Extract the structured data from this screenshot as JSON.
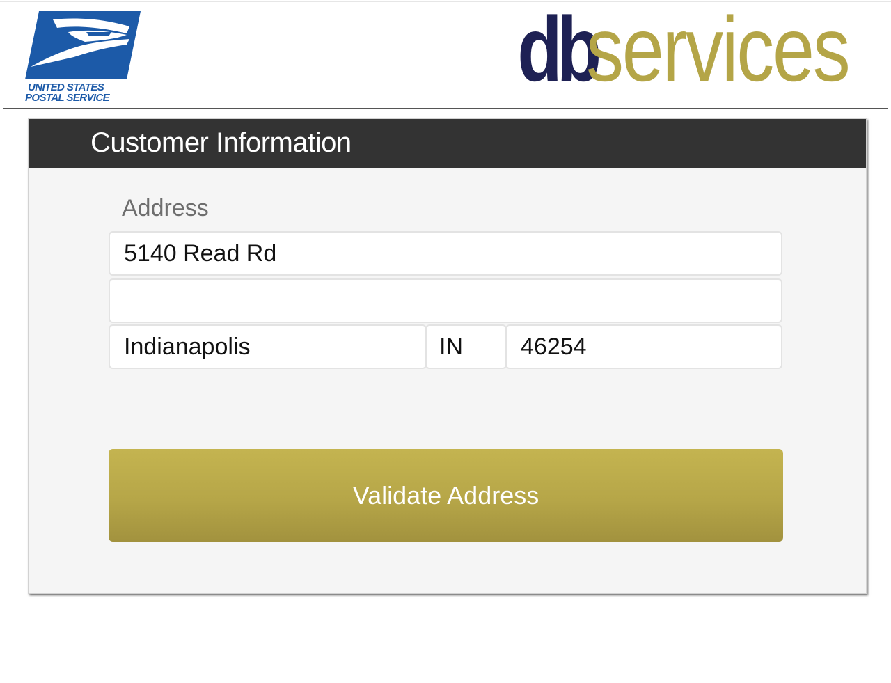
{
  "header": {
    "usps_logo": {
      "line1": "UNITED STATES",
      "line2": "POSTAL SERVICE",
      "color": "#1c5aa8"
    },
    "db_logo": {
      "bold_part": "db",
      "light_part": "services",
      "bold_color": "#1e2154",
      "light_color": "#b4a547"
    }
  },
  "card": {
    "title": "Customer Information",
    "address_label": "Address",
    "fields": {
      "street1": {
        "value": "5140 Read Rd",
        "placeholder": ""
      },
      "street2": {
        "value": "",
        "placeholder": ""
      },
      "city": {
        "value": "Indianapolis",
        "placeholder": ""
      },
      "state": {
        "value": "IN",
        "placeholder": ""
      },
      "zip": {
        "value": "46254",
        "placeholder": ""
      }
    },
    "validate_button_label": "Validate Address",
    "button_color": "#b6a648",
    "header_color": "#333333"
  }
}
